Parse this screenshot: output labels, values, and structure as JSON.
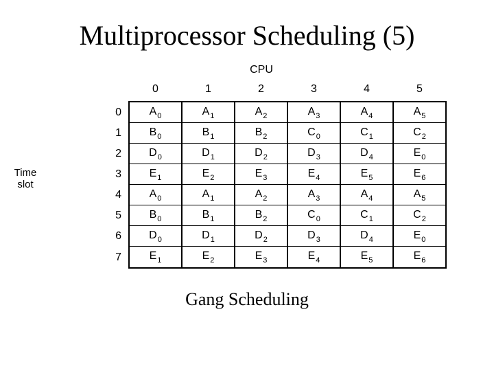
{
  "title": "Multiprocessor Scheduling (5)",
  "cpu_label": "CPU",
  "timeslot_label_line1": "Time",
  "timeslot_label_line2": "slot",
  "caption": "Gang Scheduling",
  "columns": [
    "0",
    "1",
    "2",
    "3",
    "4",
    "5"
  ],
  "row_headers": [
    "0",
    "1",
    "2",
    "3",
    "4",
    "5",
    "6",
    "7"
  ],
  "cells": [
    [
      {
        "l": "A",
        "s": "0"
      },
      {
        "l": "A",
        "s": "1"
      },
      {
        "l": "A",
        "s": "2"
      },
      {
        "l": "A",
        "s": "3"
      },
      {
        "l": "A",
        "s": "4"
      },
      {
        "l": "A",
        "s": "5"
      }
    ],
    [
      {
        "l": "B",
        "s": "0"
      },
      {
        "l": "B",
        "s": "1"
      },
      {
        "l": "B",
        "s": "2"
      },
      {
        "l": "C",
        "s": "0"
      },
      {
        "l": "C",
        "s": "1"
      },
      {
        "l": "C",
        "s": "2"
      }
    ],
    [
      {
        "l": "D",
        "s": "0"
      },
      {
        "l": "D",
        "s": "1"
      },
      {
        "l": "D",
        "s": "2"
      },
      {
        "l": "D",
        "s": "3"
      },
      {
        "l": "D",
        "s": "4"
      },
      {
        "l": "E",
        "s": "0"
      }
    ],
    [
      {
        "l": "E",
        "s": "1"
      },
      {
        "l": "E",
        "s": "2"
      },
      {
        "l": "E",
        "s": "3"
      },
      {
        "l": "E",
        "s": "4"
      },
      {
        "l": "E",
        "s": "5"
      },
      {
        "l": "E",
        "s": "6"
      }
    ],
    [
      {
        "l": "A",
        "s": "0"
      },
      {
        "l": "A",
        "s": "1"
      },
      {
        "l": "A",
        "s": "2"
      },
      {
        "l": "A",
        "s": "3"
      },
      {
        "l": "A",
        "s": "4"
      },
      {
        "l": "A",
        "s": "5"
      }
    ],
    [
      {
        "l": "B",
        "s": "0"
      },
      {
        "l": "B",
        "s": "1"
      },
      {
        "l": "B",
        "s": "2"
      },
      {
        "l": "C",
        "s": "0"
      },
      {
        "l": "C",
        "s": "1"
      },
      {
        "l": "C",
        "s": "2"
      }
    ],
    [
      {
        "l": "D",
        "s": "0"
      },
      {
        "l": "D",
        "s": "1"
      },
      {
        "l": "D",
        "s": "2"
      },
      {
        "l": "D",
        "s": "3"
      },
      {
        "l": "D",
        "s": "4"
      },
      {
        "l": "E",
        "s": "0"
      }
    ],
    [
      {
        "l": "E",
        "s": "1"
      },
      {
        "l": "E",
        "s": "2"
      },
      {
        "l": "E",
        "s": "3"
      },
      {
        "l": "E",
        "s": "4"
      },
      {
        "l": "E",
        "s": "5"
      },
      {
        "l": "E",
        "s": "6"
      }
    ]
  ]
}
